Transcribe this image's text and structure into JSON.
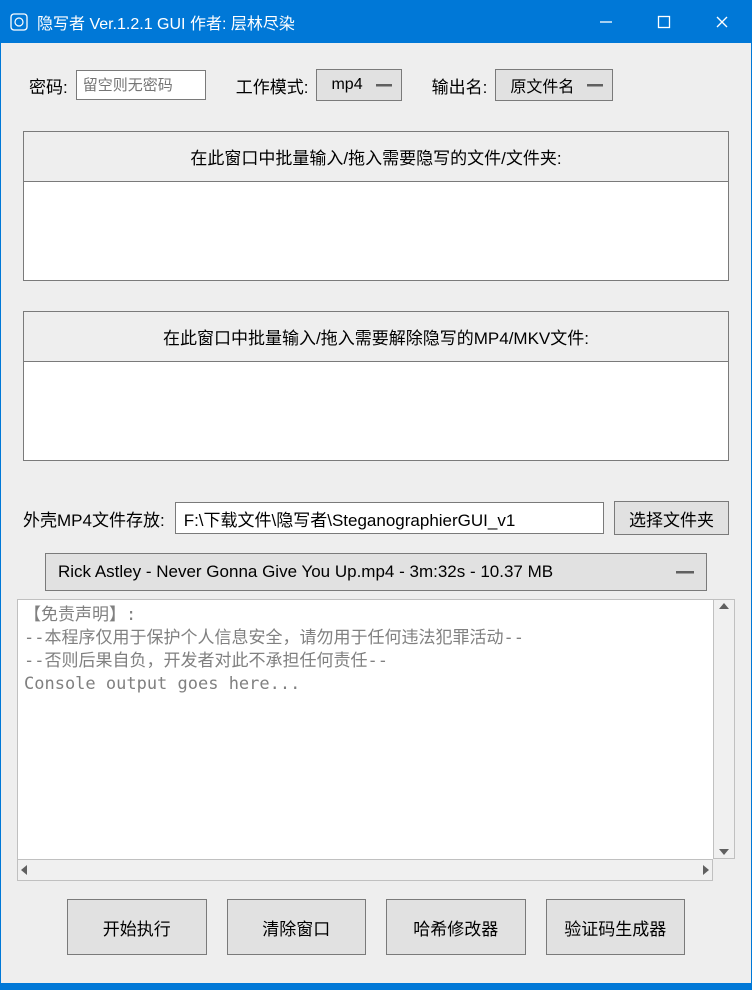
{
  "window": {
    "title": "隐写者 Ver.1.2.1 GUI 作者: 层林尽染"
  },
  "toolbar": {
    "password_label": "密码:",
    "password_placeholder": "留空则无密码",
    "mode_label": "工作模式:",
    "mode_value": "mp4",
    "output_name_label": "输出名:",
    "output_name_value": "原文件名"
  },
  "drop1": {
    "header": "在此窗口中批量输入/拖入需要隐写的文件/文件夹:"
  },
  "drop2": {
    "header": "在此窗口中批量输入/拖入需要解除隐写的MP4/MKV文件:"
  },
  "path": {
    "label": "外壳MP4文件存放:",
    "value": "F:\\下载文件\\隐写者\\SteganographierGUI_v1",
    "browse": "选择文件夹"
  },
  "file_combo": {
    "value": "Rick Astley - Never Gonna Give You Up.mp4 - 3m:32s - 10.37 MB"
  },
  "console": {
    "text": "【免责声明】:\n--本程序仅用于保护个人信息安全，请勿用于任何违法犯罪活动--\n--否则后果自负，开发者对此不承担任何责任--\nConsole output goes here..."
  },
  "buttons": {
    "start": "开始执行",
    "clear": "清除窗口",
    "hash": "哈希修改器",
    "verify": "验证码生成器"
  }
}
